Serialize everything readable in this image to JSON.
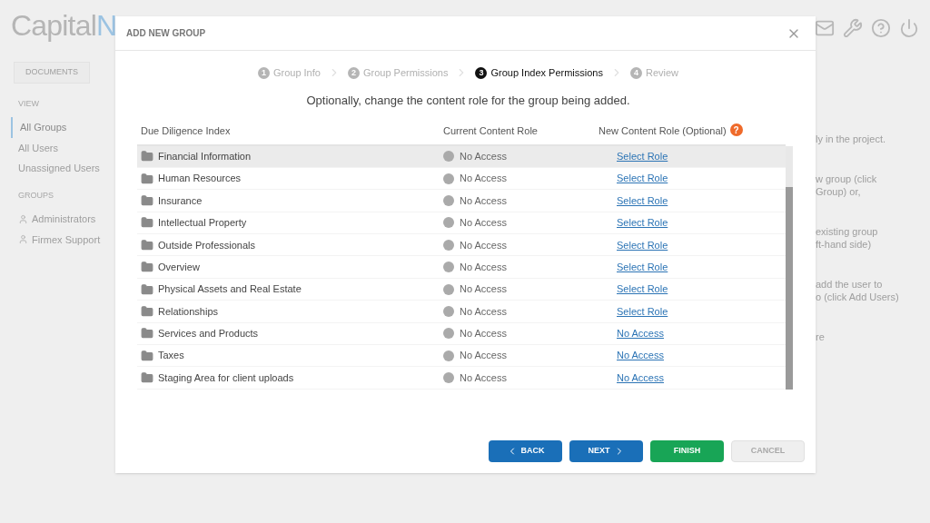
{
  "background": {
    "logo": {
      "first": "Capital",
      "second": "N"
    },
    "tabs": [
      {
        "label": "DOCUMENTS",
        "selected": false
      }
    ],
    "sidebar": {
      "sections": [
        {
          "heading": "VIEW",
          "items": [
            {
              "label": "All Groups",
              "selected": true
            },
            {
              "label": "All Users",
              "selected": false
            },
            {
              "label": "Unassigned Users",
              "selected": false
            }
          ]
        },
        {
          "heading": "GROUPS",
          "items": [
            {
              "label": "Administrators",
              "selected": false,
              "kind": "group"
            },
            {
              "label": "Firmex Support",
              "selected": false,
              "kind": "group"
            }
          ]
        }
      ]
    },
    "help_fragments": [
      "ly in the project.",
      "w group (click",
      "Group) or,",
      "existing group",
      "ft-hand side)",
      "add the user to",
      "o (click Add Users)",
      "re"
    ]
  },
  "dialog": {
    "title": "ADD NEW GROUP",
    "steps": [
      {
        "number": "1",
        "label": "Group Info",
        "selected": false
      },
      {
        "number": "2",
        "label": "Group Permissions",
        "selected": false
      },
      {
        "number": "3",
        "label": "Group Index Permissions",
        "selected": true
      },
      {
        "number": "4",
        "label": "Review",
        "selected": false
      }
    ],
    "instruction": "Optionally, change the content role for the group being added.",
    "table": {
      "help_mark": "?",
      "columns": [
        "Due Diligence Index",
        "Current Content Role",
        "New Content Role (Optional)"
      ],
      "rows": [
        {
          "name": "Financial Information",
          "current_role": "No Access",
          "new_role": "Select Role",
          "highlighted": true
        },
        {
          "name": "Human Resources",
          "current_role": "No Access",
          "new_role": "Select Role",
          "highlighted": false
        },
        {
          "name": "Insurance",
          "current_role": "No Access",
          "new_role": "Select Role",
          "highlighted": false
        },
        {
          "name": "Intellectual Property",
          "current_role": "No Access",
          "new_role": "Select Role",
          "highlighted": false
        },
        {
          "name": "Outside Professionals",
          "current_role": "No Access",
          "new_role": "Select Role",
          "highlighted": false
        },
        {
          "name": "Overview",
          "current_role": "No Access",
          "new_role": "Select Role",
          "highlighted": false
        },
        {
          "name": "Physical Assets and Real Estate",
          "current_role": "No Access",
          "new_role": "Select Role",
          "highlighted": false
        },
        {
          "name": "Relationships",
          "current_role": "No Access",
          "new_role": "Select Role",
          "highlighted": false
        },
        {
          "name": "Services and Products",
          "current_role": "No Access",
          "new_role": "No Access",
          "highlighted": false
        },
        {
          "name": "Taxes",
          "current_role": "No Access",
          "new_role": "No Access",
          "highlighted": false
        },
        {
          "name": "Staging Area for client uploads",
          "current_role": "No Access",
          "new_role": "No Access",
          "highlighted": false
        }
      ]
    },
    "buttons": [
      {
        "label": "BACK",
        "kind": "back"
      },
      {
        "label": "NEXT",
        "kind": "next"
      },
      {
        "label": "FINISH",
        "kind": "finish"
      },
      {
        "label": "CANCEL",
        "kind": "cancel"
      }
    ]
  }
}
